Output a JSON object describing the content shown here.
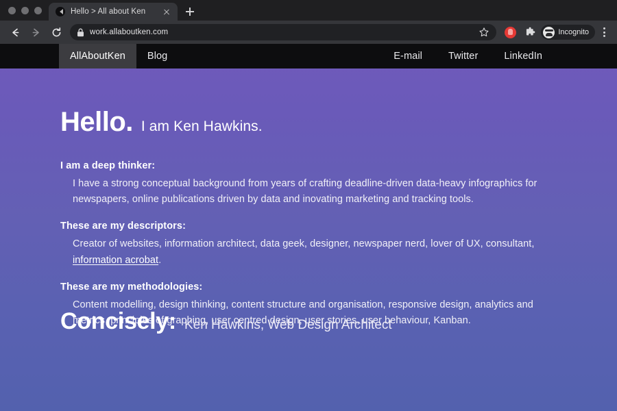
{
  "browser": {
    "window_controls": [
      "close",
      "minimize",
      "maximize"
    ],
    "tab": {
      "title": "Hello > All about Ken",
      "favicon_name": "site-favicon",
      "close_label": "×"
    },
    "new_tab_label": "+",
    "toolbar": {
      "back_label": "Back",
      "forward_label": "Forward",
      "reload_label": "Reload",
      "lock_label": "Secure",
      "url": "work.allaboutken.com",
      "bookmark_label": "Bookmark this tab",
      "extension_red_label": "Extension",
      "extensions_label": "Extensions",
      "incognito_label": "Incognito",
      "menu_label": "Customize and control Chrome"
    }
  },
  "site": {
    "nav_left": [
      {
        "label": "AllAboutKen",
        "active": true
      },
      {
        "label": "Blog",
        "active": false
      }
    ],
    "nav_right": [
      {
        "label": "E-mail"
      },
      {
        "label": "Twitter"
      },
      {
        "label": "LinkedIn"
      }
    ],
    "hero": {
      "headline": "Hello.",
      "subhead": "I am Ken Hawkins."
    },
    "blocks": [
      {
        "title": "I am a deep thinker:",
        "body": "I have a strong conceptual background from years of crafting deadline-driven data-heavy infographics for newspapers, online publications driven by data and inovating marketing and tracking tools."
      },
      {
        "title": "These are my descriptors:",
        "body_before": "Creator of websites, information architect, data geek, designer, newspaper nerd, lover of UX, consultant, ",
        "link": "information acrobat",
        "body_after": "."
      },
      {
        "title": "These are my methodologies:",
        "body": "Content modelling, design thinking, content structure and organisation, responsive design, analytics and metrics, principles of graphing, user centred design, user stories, user behaviour, Kanban."
      }
    ],
    "lower_section": {
      "title": "Concisely:",
      "subtitle": "Ken Hawkins, Web Design Architect"
    },
    "colors": {
      "bg_top": "#7059bb",
      "bg_bottom": "#5361ae",
      "nav_bg": "#0d0d0f",
      "nav_active_bg": "#3c3c40",
      "text": "#ffffff"
    }
  }
}
